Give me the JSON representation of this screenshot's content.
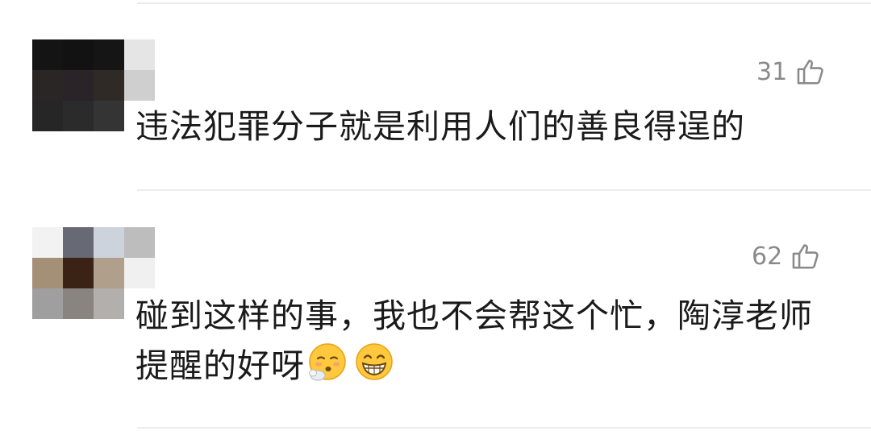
{
  "comments": [
    {
      "text": "违法犯罪分子就是利用人们的善良得逞的",
      "like_count": "31",
      "like_icon": "thumbs-up-outline-icon",
      "avatar": "pixelated-avatar"
    },
    {
      "text": "碰到这样的事，我也不会帮这个忙，陶淳老师提醒的好呀",
      "like_count": "62",
      "like_icon": "thumbs-up-outline-icon",
      "avatar": "pixelated-avatar",
      "emojis": [
        "sighing-face-emoji",
        "grinning-face-emoji"
      ]
    }
  ],
  "colors": {
    "text": "#1a1a1a",
    "muted": "#8a8a8a",
    "divider": "#ececec"
  }
}
